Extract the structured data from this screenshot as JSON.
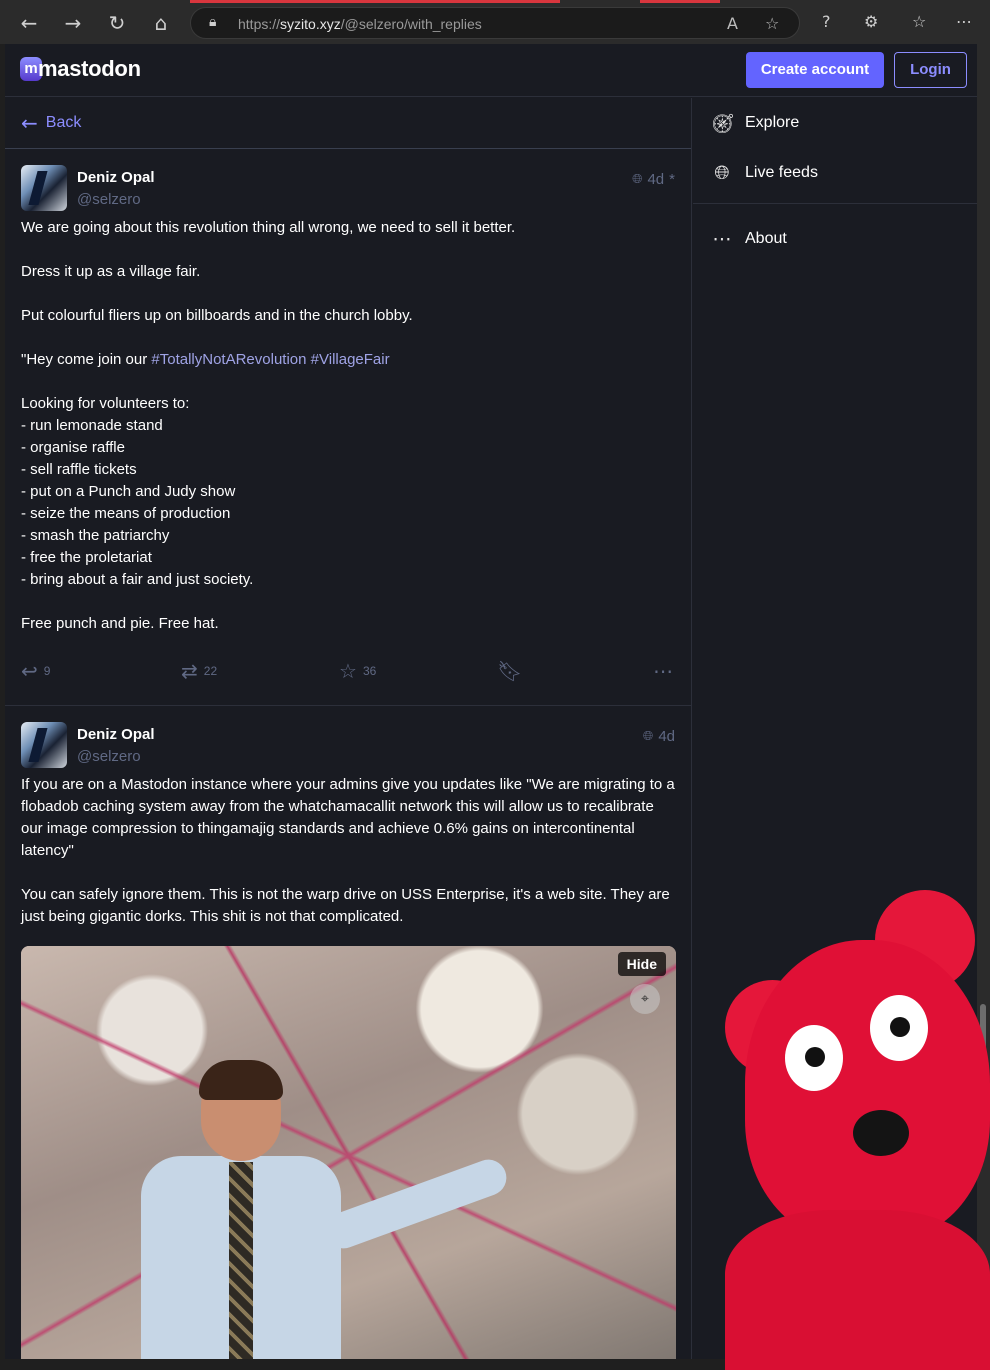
{
  "browser": {
    "url_host": "https://syzito.xyz/",
    "url_path": "@selzero/with_replies",
    "url_domain_display": "syzito.xyz"
  },
  "topbar": {
    "logo_text": "mastodon",
    "create_account": "Create account",
    "login": "Login"
  },
  "column": {
    "back_label": "Back"
  },
  "sidebar": {
    "items": [
      {
        "label": "Explore",
        "icon": "compass-icon"
      },
      {
        "label": "Live feeds",
        "icon": "globe-icon"
      },
      {
        "label": "About",
        "icon": "ellipsis-icon"
      }
    ]
  },
  "posts": [
    {
      "display_name": "Deniz Opal",
      "handle": "@selzero",
      "time": "4d",
      "edited_mark": "*",
      "paragraphs": [
        "We are going about this revolution thing all wrong, we need to sell it better.",
        "Dress it up as a village fair.",
        "Put colourful fliers up on billboards and in the church lobby.",
        "\"Hey come join our ",
        "Looking for volunteers to:\n- run lemonade stand\n- organise raffle\n- sell raffle tickets\n- put on a Punch and Judy show\n- seize the means of production\n- smash the patriarchy\n- free the proletariat\n- bring about a fair and just society.",
        "Free punch and pie. Free hat."
      ],
      "hashtags": [
        "#TotallyNotARevolution",
        "#VillageFair"
      ],
      "replies": "9",
      "boosts": "22",
      "favourites": "36"
    },
    {
      "display_name": "Deniz Opal",
      "handle": "@selzero",
      "time": "4d",
      "paragraphs": [
        "If you are on a Mastodon instance where your admins give you updates like \"We are migrating to a flobadob caching system away from the whatchamacallit network this will allow us to recalibrate our image compression to thingamajig standards and achieve 0.6% gains on intercontinental latency\"",
        "You can safely ignore them. This is not the warp drive on USS Enterprise, it's a web site. They are just being gigantic dorks. This shit is not that complicated."
      ],
      "media_hide": "Hide"
    }
  ],
  "colors": {
    "accent": "#6364ff",
    "link": "#8c8dff",
    "background": "#191b22",
    "muted": "#606984"
  }
}
